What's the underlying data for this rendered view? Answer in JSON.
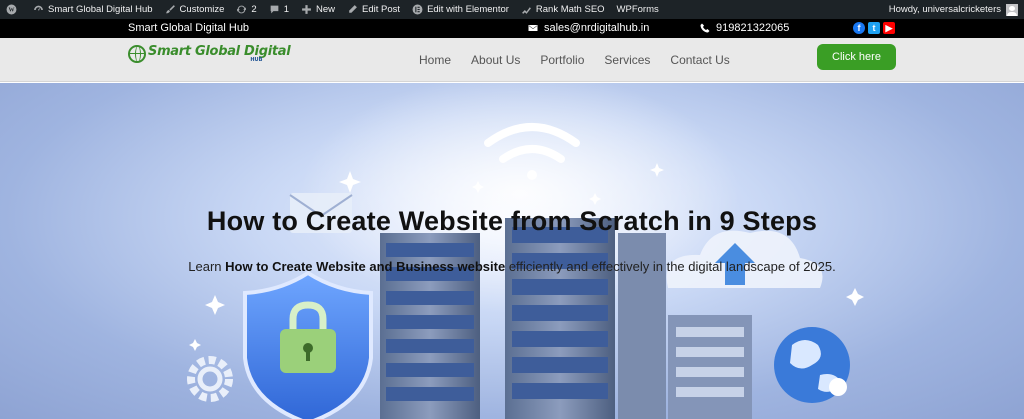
{
  "admin_bar": {
    "site_name": "Smart Global Digital Hub",
    "customize": "Customize",
    "updates_count": "2",
    "comments_count": "1",
    "new": "New",
    "edit_post": "Edit Post",
    "edit_elementor": "Edit with Elementor",
    "rank_math": "Rank Math SEO",
    "wpforms": "WPForms",
    "howdy": "Howdy, universalcricketers"
  },
  "top_bar": {
    "brand": "Smart Global Digital Hub",
    "email": "sales@nrdigitalhub.in",
    "phone": "919821322065",
    "social": [
      "f",
      "t",
      "▶"
    ]
  },
  "header": {
    "logo_title": "Smart Global Digital",
    "logo_sub": "HUB",
    "nav": [
      "Home",
      "About Us",
      "Portfolio",
      "Services",
      "Contact Us"
    ],
    "cta": "Click here"
  },
  "hero": {
    "title": "How to Create Website from Scratch in 9 Steps",
    "sub_prefix": "Learn ",
    "sub_bold": "How to Create Website and Business website",
    "sub_suffix": " efficiently and effectively in the digital landscape of 2025."
  },
  "colors": {
    "admin_bg": "#1d2327",
    "accent_green": "#3a9e25",
    "logo_blue": "#1a4f91"
  }
}
